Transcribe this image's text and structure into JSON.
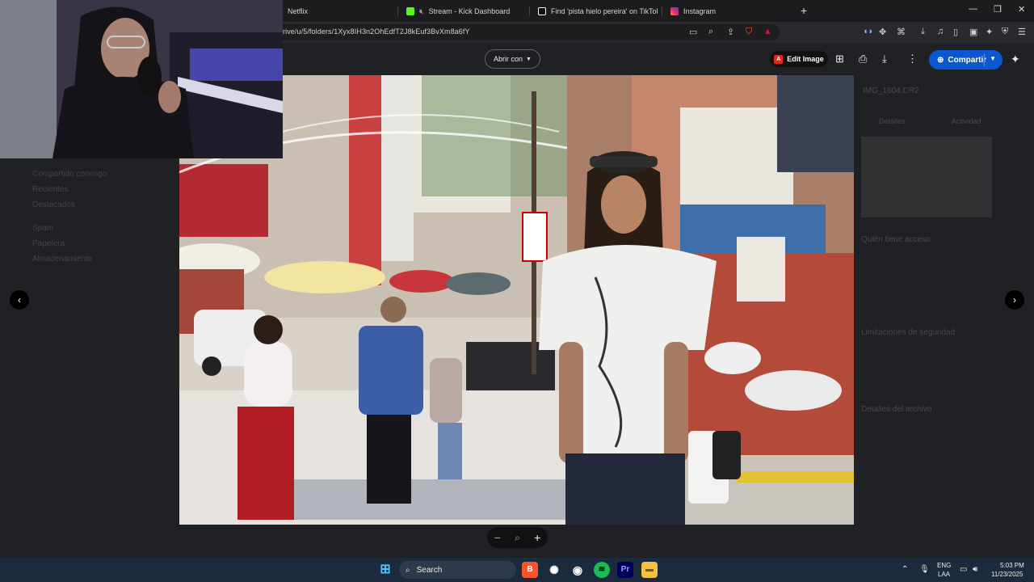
{
  "browser": {
    "tabs": [
      {
        "label": "Netflix",
        "color": "#e50914"
      },
      {
        "label": "Stream - Kick Dashboard",
        "color": "#53fc18"
      },
      {
        "label": "Find 'pista hielo pereira' on TikTok | T",
        "color": "#ffffff"
      },
      {
        "label": "Instagram",
        "color": "#e1306c"
      }
    ],
    "new_tab": "+",
    "url": "rive/u/5/folders/1Xyx8IH3n2OhEdfT2J8kEuf3BvXm8a6fY",
    "window": {
      "minimize": "—",
      "restore": "❐",
      "close": "✕"
    }
  },
  "viewer": {
    "open_with_label": "Abrir con",
    "edit_image_label": "Edit Image",
    "share_label": "Compartir",
    "prev_icon": "chevron-left-icon",
    "next_icon": "chevron-right-icon",
    "zoom_out": "−",
    "zoom_in": "+",
    "accent": "#0b57d0"
  },
  "background_drive": {
    "nav_items": [
      "Compartido conmigo",
      "Recientes",
      "Destacados",
      "Spam",
      "Papelera",
      "Almacenamiento"
    ]
  },
  "side_panel": {
    "file_name": "IMG_1604.CR2",
    "tabs": [
      "Detalles",
      "Actividad"
    ],
    "sections": [
      "Quién tiene acceso",
      "Limitaciones de seguridad",
      "Detalles del archivo"
    ]
  },
  "taskbar": {
    "search_placeholder": "Search",
    "language_top": "ENG",
    "language_bottom": "LAA",
    "time": "5:03 PM",
    "date": "11/23/2025"
  }
}
